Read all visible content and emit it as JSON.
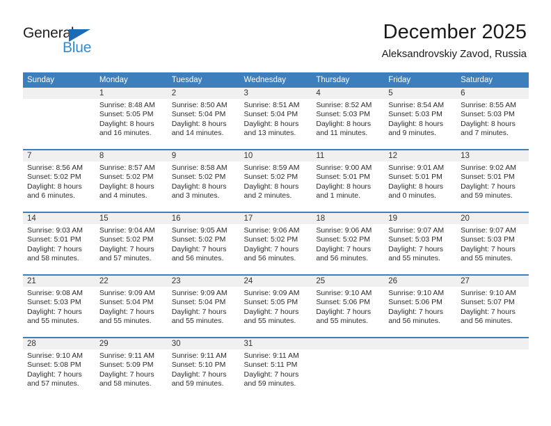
{
  "brand": {
    "name_part1": "General",
    "name_part2": "Blue",
    "color_dark": "#231f20",
    "color_blue": "#2e8bd6",
    "triangle_color": "#1b6cb5"
  },
  "header": {
    "title": "December 2025",
    "subtitle": "Aleksandrovskiy Zavod, Russia",
    "header_bg": "#3d7ebd",
    "daynum_bg": "#f0f0f0"
  },
  "weekday_headers": [
    "Sunday",
    "Monday",
    "Tuesday",
    "Wednesday",
    "Thursday",
    "Friday",
    "Saturday"
  ],
  "weeks": [
    [
      {
        "day": "",
        "sunrise": "",
        "sunset": "",
        "daylight1": "",
        "daylight2": ""
      },
      {
        "day": "1",
        "sunrise": "Sunrise: 8:48 AM",
        "sunset": "Sunset: 5:05 PM",
        "daylight1": "Daylight: 8 hours",
        "daylight2": "and 16 minutes."
      },
      {
        "day": "2",
        "sunrise": "Sunrise: 8:50 AM",
        "sunset": "Sunset: 5:04 PM",
        "daylight1": "Daylight: 8 hours",
        "daylight2": "and 14 minutes."
      },
      {
        "day": "3",
        "sunrise": "Sunrise: 8:51 AM",
        "sunset": "Sunset: 5:04 PM",
        "daylight1": "Daylight: 8 hours",
        "daylight2": "and 13 minutes."
      },
      {
        "day": "4",
        "sunrise": "Sunrise: 8:52 AM",
        "sunset": "Sunset: 5:03 PM",
        "daylight1": "Daylight: 8 hours",
        "daylight2": "and 11 minutes."
      },
      {
        "day": "5",
        "sunrise": "Sunrise: 8:54 AM",
        "sunset": "Sunset: 5:03 PM",
        "daylight1": "Daylight: 8 hours",
        "daylight2": "and 9 minutes."
      },
      {
        "day": "6",
        "sunrise": "Sunrise: 8:55 AM",
        "sunset": "Sunset: 5:03 PM",
        "daylight1": "Daylight: 8 hours",
        "daylight2": "and 7 minutes."
      }
    ],
    [
      {
        "day": "7",
        "sunrise": "Sunrise: 8:56 AM",
        "sunset": "Sunset: 5:02 PM",
        "daylight1": "Daylight: 8 hours",
        "daylight2": "and 6 minutes."
      },
      {
        "day": "8",
        "sunrise": "Sunrise: 8:57 AM",
        "sunset": "Sunset: 5:02 PM",
        "daylight1": "Daylight: 8 hours",
        "daylight2": "and 4 minutes."
      },
      {
        "day": "9",
        "sunrise": "Sunrise: 8:58 AM",
        "sunset": "Sunset: 5:02 PM",
        "daylight1": "Daylight: 8 hours",
        "daylight2": "and 3 minutes."
      },
      {
        "day": "10",
        "sunrise": "Sunrise: 8:59 AM",
        "sunset": "Sunset: 5:02 PM",
        "daylight1": "Daylight: 8 hours",
        "daylight2": "and 2 minutes."
      },
      {
        "day": "11",
        "sunrise": "Sunrise: 9:00 AM",
        "sunset": "Sunset: 5:01 PM",
        "daylight1": "Daylight: 8 hours",
        "daylight2": "and 1 minute."
      },
      {
        "day": "12",
        "sunrise": "Sunrise: 9:01 AM",
        "sunset": "Sunset: 5:01 PM",
        "daylight1": "Daylight: 8 hours",
        "daylight2": "and 0 minutes."
      },
      {
        "day": "13",
        "sunrise": "Sunrise: 9:02 AM",
        "sunset": "Sunset: 5:01 PM",
        "daylight1": "Daylight: 7 hours",
        "daylight2": "and 59 minutes."
      }
    ],
    [
      {
        "day": "14",
        "sunrise": "Sunrise: 9:03 AM",
        "sunset": "Sunset: 5:01 PM",
        "daylight1": "Daylight: 7 hours",
        "daylight2": "and 58 minutes."
      },
      {
        "day": "15",
        "sunrise": "Sunrise: 9:04 AM",
        "sunset": "Sunset: 5:02 PM",
        "daylight1": "Daylight: 7 hours",
        "daylight2": "and 57 minutes."
      },
      {
        "day": "16",
        "sunrise": "Sunrise: 9:05 AM",
        "sunset": "Sunset: 5:02 PM",
        "daylight1": "Daylight: 7 hours",
        "daylight2": "and 56 minutes."
      },
      {
        "day": "17",
        "sunrise": "Sunrise: 9:06 AM",
        "sunset": "Sunset: 5:02 PM",
        "daylight1": "Daylight: 7 hours",
        "daylight2": "and 56 minutes."
      },
      {
        "day": "18",
        "sunrise": "Sunrise: 9:06 AM",
        "sunset": "Sunset: 5:02 PM",
        "daylight1": "Daylight: 7 hours",
        "daylight2": "and 56 minutes."
      },
      {
        "day": "19",
        "sunrise": "Sunrise: 9:07 AM",
        "sunset": "Sunset: 5:03 PM",
        "daylight1": "Daylight: 7 hours",
        "daylight2": "and 55 minutes."
      },
      {
        "day": "20",
        "sunrise": "Sunrise: 9:07 AM",
        "sunset": "Sunset: 5:03 PM",
        "daylight1": "Daylight: 7 hours",
        "daylight2": "and 55 minutes."
      }
    ],
    [
      {
        "day": "21",
        "sunrise": "Sunrise: 9:08 AM",
        "sunset": "Sunset: 5:03 PM",
        "daylight1": "Daylight: 7 hours",
        "daylight2": "and 55 minutes."
      },
      {
        "day": "22",
        "sunrise": "Sunrise: 9:09 AM",
        "sunset": "Sunset: 5:04 PM",
        "daylight1": "Daylight: 7 hours",
        "daylight2": "and 55 minutes."
      },
      {
        "day": "23",
        "sunrise": "Sunrise: 9:09 AM",
        "sunset": "Sunset: 5:04 PM",
        "daylight1": "Daylight: 7 hours",
        "daylight2": "and 55 minutes."
      },
      {
        "day": "24",
        "sunrise": "Sunrise: 9:09 AM",
        "sunset": "Sunset: 5:05 PM",
        "daylight1": "Daylight: 7 hours",
        "daylight2": "and 55 minutes."
      },
      {
        "day": "25",
        "sunrise": "Sunrise: 9:10 AM",
        "sunset": "Sunset: 5:06 PM",
        "daylight1": "Daylight: 7 hours",
        "daylight2": "and 55 minutes."
      },
      {
        "day": "26",
        "sunrise": "Sunrise: 9:10 AM",
        "sunset": "Sunset: 5:06 PM",
        "daylight1": "Daylight: 7 hours",
        "daylight2": "and 56 minutes."
      },
      {
        "day": "27",
        "sunrise": "Sunrise: 9:10 AM",
        "sunset": "Sunset: 5:07 PM",
        "daylight1": "Daylight: 7 hours",
        "daylight2": "and 56 minutes."
      }
    ],
    [
      {
        "day": "28",
        "sunrise": "Sunrise: 9:10 AM",
        "sunset": "Sunset: 5:08 PM",
        "daylight1": "Daylight: 7 hours",
        "daylight2": "and 57 minutes."
      },
      {
        "day": "29",
        "sunrise": "Sunrise: 9:11 AM",
        "sunset": "Sunset: 5:09 PM",
        "daylight1": "Daylight: 7 hours",
        "daylight2": "and 58 minutes."
      },
      {
        "day": "30",
        "sunrise": "Sunrise: 9:11 AM",
        "sunset": "Sunset: 5:10 PM",
        "daylight1": "Daylight: 7 hours",
        "daylight2": "and 59 minutes."
      },
      {
        "day": "31",
        "sunrise": "Sunrise: 9:11 AM",
        "sunset": "Sunset: 5:11 PM",
        "daylight1": "Daylight: 7 hours",
        "daylight2": "and 59 minutes."
      },
      {
        "day": "",
        "sunrise": "",
        "sunset": "",
        "daylight1": "",
        "daylight2": ""
      },
      {
        "day": "",
        "sunrise": "",
        "sunset": "",
        "daylight1": "",
        "daylight2": ""
      },
      {
        "day": "",
        "sunrise": "",
        "sunset": "",
        "daylight1": "",
        "daylight2": ""
      }
    ]
  ]
}
